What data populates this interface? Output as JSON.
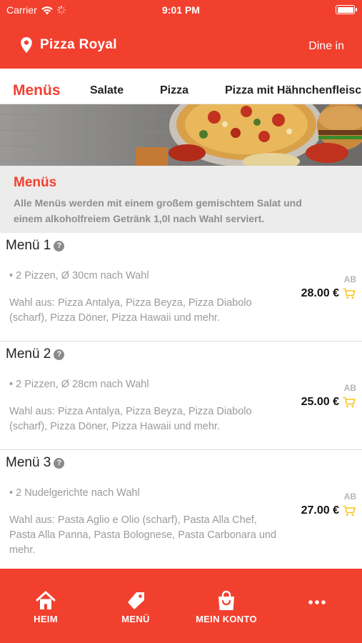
{
  "status_bar": {
    "carrier": "Carrier",
    "time": "9:01 PM"
  },
  "header": {
    "restaurant_name": "Pizza Royal",
    "order_mode": "Dine in"
  },
  "tabs": [
    {
      "label": "Menüs",
      "active": true
    },
    {
      "label": "Salate",
      "active": false
    },
    {
      "label": "Pizza",
      "active": false
    },
    {
      "label": "Pizza mit Hähnchenfleisch",
      "active": false
    }
  ],
  "category": {
    "title": "Menüs",
    "description_line1": "Alle Menüs werden mit einem großem gemischtem Salat und",
    "description_line2": "einem alkoholfreiem Getränk 1,0l nach Wahl serviert."
  },
  "items": [
    {
      "name": "Menü 1",
      "line1": "• 2 Pizzen, Ø 30cm nach Wahl",
      "line2": "Wahl aus: Pizza Antalya, Pizza Beyza, Pizza Diabolo (scharf), Pizza Döner, Pizza Hawaii und mehr.",
      "price_prefix": "AB",
      "price": "28.00 €"
    },
    {
      "name": "Menü 2",
      "line1": "• 2 Pizzen, Ø 28cm nach Wahl",
      "line2": "Wahl aus: Pizza Antalya, Pizza Beyza, Pizza Diabolo (scharf), Pizza Döner, Pizza Hawaii und mehr.",
      "price_prefix": "AB",
      "price": "25.00 €"
    },
    {
      "name": "Menü 3",
      "line1": "• 2 Nudelgerichte nach Wahl",
      "line2": "Wahl aus: Pasta Aglio e Olio (scharf), Pasta Alla Chef, Pasta Alla Panna, Pasta Bolognese, Pasta Carbonara und mehr.",
      "price_prefix": "AB",
      "price": "27.00 €"
    }
  ],
  "help_symbol": "?",
  "bottom_nav": [
    {
      "label": "HEIM",
      "icon": "home-icon"
    },
    {
      "label": "MENÜ",
      "icon": "tag-icon"
    },
    {
      "label": "MEIN KONTO",
      "icon": "bag-icon"
    },
    {
      "label": "",
      "icon": "more-icon"
    }
  ],
  "colors": {
    "brand": "#f2402f",
    "cart": "#f5c518",
    "muted": "#9a9a9a",
    "section_bg": "#ececec"
  }
}
